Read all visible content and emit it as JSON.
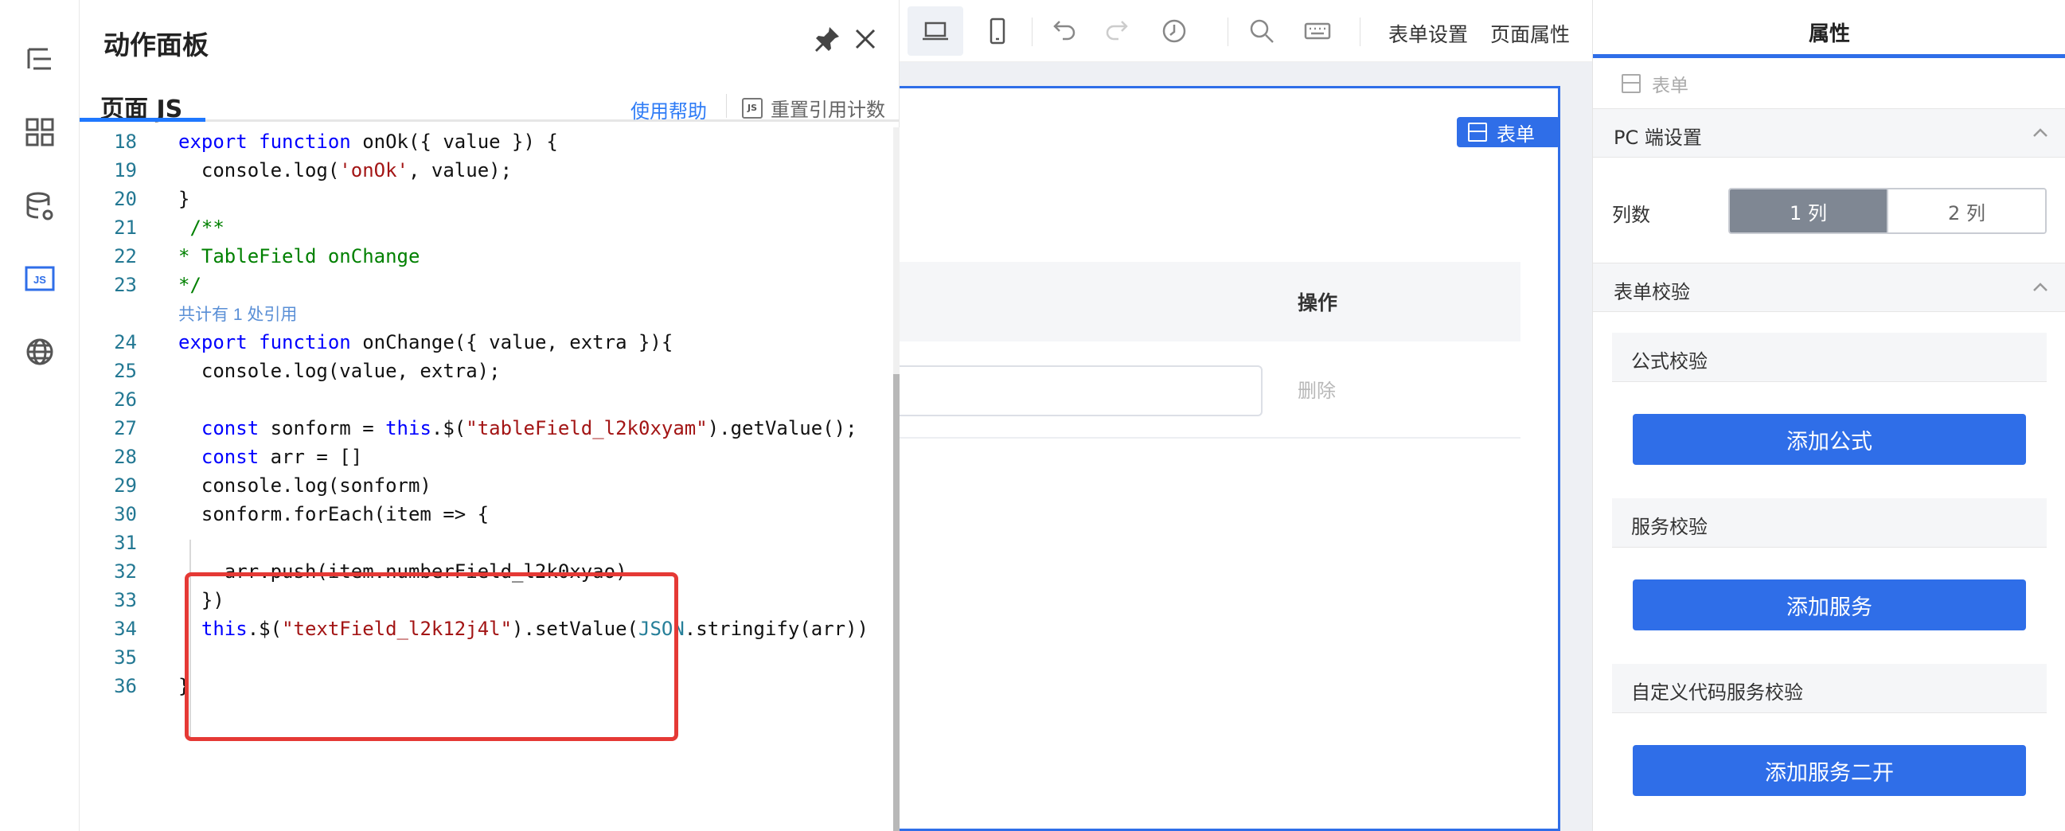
{
  "rail": {
    "icons": [
      "outline-icon",
      "components-icon",
      "datasource-icon",
      "js-icon",
      "globe-icon"
    ]
  },
  "panel": {
    "title": "动作面板",
    "tab": "页面 JS",
    "help": "使用帮助",
    "recount": "重置引用计数",
    "js_badge": "JS"
  },
  "code": {
    "lines": [
      {
        "n": "18",
        "t": "export function onOk({ value }) {"
      },
      {
        "n": "19",
        "t": "  console.log('onOk', value);"
      },
      {
        "n": "20",
        "t": "}"
      },
      {
        "n": "21",
        "t": " /**"
      },
      {
        "n": "22",
        "t": "* TableField onChange"
      },
      {
        "n": "23",
        "t": "*/"
      },
      {
        "n": "24",
        "t": "export function onChange({ value, extra }){"
      },
      {
        "n": "25",
        "t": "  console.log(value, extra);"
      },
      {
        "n": "26",
        "t": ""
      },
      {
        "n": "27",
        "t": "  const sonform = this.$(\"tableField_l2k0xyam\").getValue();"
      },
      {
        "n": "28",
        "t": "  const arr = []"
      },
      {
        "n": "29",
        "t": "  console.log(sonform)"
      },
      {
        "n": "30",
        "t": "  sonform.forEach(item => {"
      },
      {
        "n": "31",
        "t": ""
      },
      {
        "n": "32",
        "t": "    arr.push(item.numberField_l2k0xyao)"
      },
      {
        "n": "33",
        "t": "  })"
      },
      {
        "n": "34",
        "t": "  this.$(\"textField_l2k12j4l\").setValue(JSON.stringify(arr))"
      },
      {
        "n": "35",
        "t": ""
      },
      {
        "n": "36",
        "t": "}"
      }
    ],
    "ref_hint": "共计有 1 处引用"
  },
  "toolbar": {
    "form_settings": "表单设置",
    "page_props": "页面属性"
  },
  "canvas": {
    "form_badge": "表单",
    "col_op": "操作",
    "delete": "删除"
  },
  "props": {
    "title": "属性",
    "crumb": "表单",
    "pc_settings": "PC 端设置",
    "columns_label": "列数",
    "col1": "1 列",
    "col2": "2 列",
    "validation": "表单校验",
    "formula_validation": "公式校验",
    "add_formula": "添加公式",
    "service_validation": "服务校验",
    "add_service": "添加服务",
    "custom_validation": "自定义代码服务校验",
    "add_service_dev": "添加服务二开"
  },
  "colors": {
    "accent": "#2f6ee8",
    "highlight_box": "#e53935"
  }
}
